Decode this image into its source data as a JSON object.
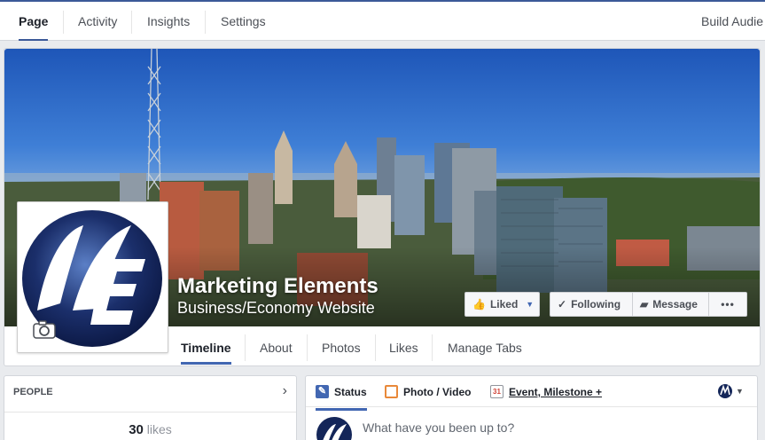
{
  "admin_tabs": [
    {
      "label": "Page",
      "active": true
    },
    {
      "label": "Activity",
      "active": false
    },
    {
      "label": "Insights",
      "active": false
    },
    {
      "label": "Settings",
      "active": false
    }
  ],
  "admin_right_link": "Build Audie",
  "page": {
    "name": "Marketing Elements",
    "category": "Business/Economy Website",
    "profile_letters": "ME"
  },
  "cover_buttons": {
    "liked": "Liked",
    "following": "Following",
    "message": "Message",
    "more": "•••"
  },
  "page_tabs": [
    {
      "label": "Timeline",
      "active": true
    },
    {
      "label": "About",
      "active": false
    },
    {
      "label": "Photos",
      "active": false
    },
    {
      "label": "Likes",
      "active": false
    },
    {
      "label": "Manage Tabs",
      "active": false
    }
  ],
  "people_card": {
    "header": "PEOPLE",
    "likes_count": "30",
    "likes_label": "likes"
  },
  "composer": {
    "tabs": [
      {
        "label": "Status",
        "icon": "pencil-icon"
      },
      {
        "label": "Photo / Video",
        "icon": "photo-icon"
      },
      {
        "label": "Event, Milestone +",
        "icon": "calendar-icon"
      }
    ],
    "calendar_day": "31",
    "placeholder": "What have you been up to?"
  },
  "colors": {
    "brand_blue": "#3b5998",
    "accent_blue": "#4267b2",
    "logo_navy": "#0f1f4b"
  }
}
